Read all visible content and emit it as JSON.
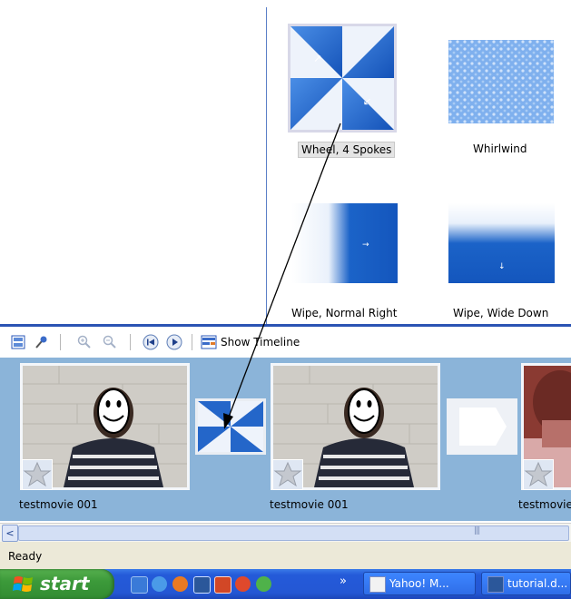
{
  "transitions": [
    {
      "label": "Wheel, 4 Spokes",
      "icon": "wheel-4-spokes-preview",
      "selected": true
    },
    {
      "label": "Whirlwind",
      "icon": "whirlwind-preview",
      "selected": false
    },
    {
      "label": "Wipe, Normal Right",
      "icon": "wipe-normal-right-preview",
      "selected": false
    },
    {
      "label": "Wipe, Wide Down",
      "icon": "wipe-wide-down-preview",
      "selected": false
    }
  ],
  "toolbar": {
    "show_timeline_label": "Show Timeline",
    "icons": [
      "storyboard-icon",
      "narrate-icon",
      "zoom-in-icon",
      "zoom-out-icon",
      "rewind-icon",
      "play-icon",
      "timeline-icon"
    ]
  },
  "storyboard": {
    "clips": [
      {
        "label": "testmovie 001"
      },
      {
        "label": "testmovie 001"
      },
      {
        "label": "testmovie"
      }
    ],
    "transition_slots": [
      {
        "icon": "wheel-4-spokes-icon"
      },
      {
        "icon": "empty-transition-icon"
      }
    ]
  },
  "status_bar": {
    "text": "Ready"
  },
  "taskbar": {
    "start_label": "start",
    "overflow": "»",
    "tasks": [
      {
        "label": "Yahoo! M..."
      },
      {
        "label": "tutorial.d..."
      }
    ]
  },
  "colors": {
    "accent": "#2b54b4",
    "storyboard_bg": "#8bb4d9",
    "selection_blue": "#1e62c8"
  }
}
